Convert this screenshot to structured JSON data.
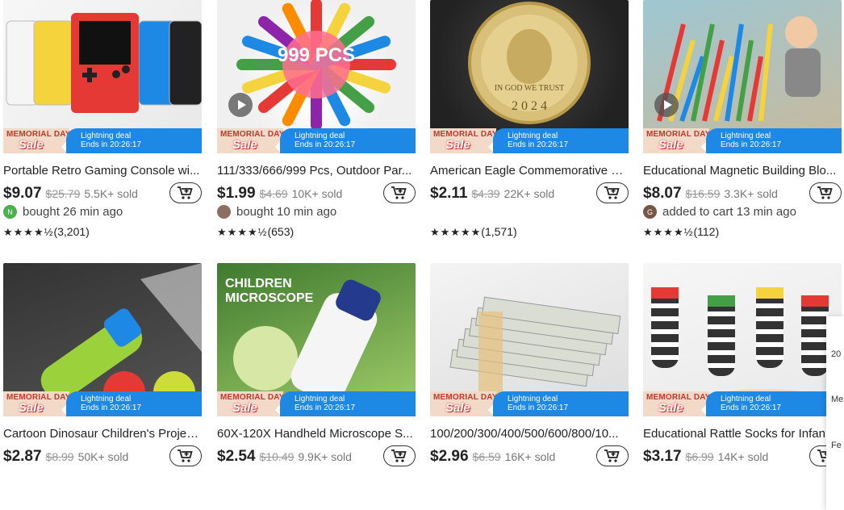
{
  "products": [
    {
      "title": "Portable Retro Gaming Console wi...",
      "price": "$9.07",
      "orig": "$25.79",
      "sold": "5.5K+ sold",
      "social": "bought 26 min ago",
      "avatar": "N",
      "avatar_color": "#4caf50",
      "stars": "★★★★½",
      "reviews": "(3,201)",
      "has_video": false
    },
    {
      "title": "111/333/666/999 Pcs, Outdoor Par...",
      "price": "$1.99",
      "orig": "$4.69",
      "sold": "10K+ sold",
      "social": "bought 10 min ago",
      "avatar": "",
      "avatar_color": "#8d6e63",
      "stars": "★★★★½",
      "reviews": "(653)",
      "has_video": true,
      "img_text": "999 PCS"
    },
    {
      "title": "American Eagle Commemorative C...",
      "price": "$2.11",
      "orig": "$4.39",
      "sold": "22K+ sold",
      "social": "",
      "avatar": "",
      "avatar_color": "",
      "stars": "★★★★★",
      "reviews": "(1,571)",
      "has_video": false,
      "img_text": "IN GOD WE TRUST"
    },
    {
      "title": "Educational Magnetic Building Blo...",
      "price": "$8.07",
      "orig": "$16.59",
      "sold": "3.3K+ sold",
      "social": "added to cart 13 min ago",
      "avatar": "G",
      "avatar_color": "#795548",
      "stars": "★★★★½",
      "reviews": "(112)",
      "has_video": true
    },
    {
      "title": "Cartoon Dinosaur Children's Projec...",
      "price": "$2.87",
      "orig": "$8.99",
      "sold": "50K+ sold",
      "has_video": true
    },
    {
      "title": "60X-120X Handheld Microscope S...",
      "price": "$2.54",
      "orig": "$10.49",
      "sold": "9.9K+ sold",
      "has_video": false,
      "img_text": "CHILDREN\nMICROSCOPE"
    },
    {
      "title": "100/200/300/400/500/600/800/10...",
      "price": "$2.96",
      "orig": "$6.59",
      "sold": "16K+ sold",
      "has_video": true
    },
    {
      "title": "Educational Rattle Socks for Infan...",
      "price": "$3.17",
      "orig": "$6.99",
      "sold": "14K+ sold",
      "has_video": false
    }
  ],
  "banner": {
    "memorial_line1": "MEMORIAL DAY",
    "memorial_line2": "Sale",
    "deal_line1": "Lightning deal",
    "deal_line2": "Ends in 20:26:17"
  },
  "side_panel": [
    "20",
    "Me",
    "Fe"
  ],
  "colors": {
    "deal_blue": "#1e88e5",
    "sale_red": "#c0392b"
  }
}
